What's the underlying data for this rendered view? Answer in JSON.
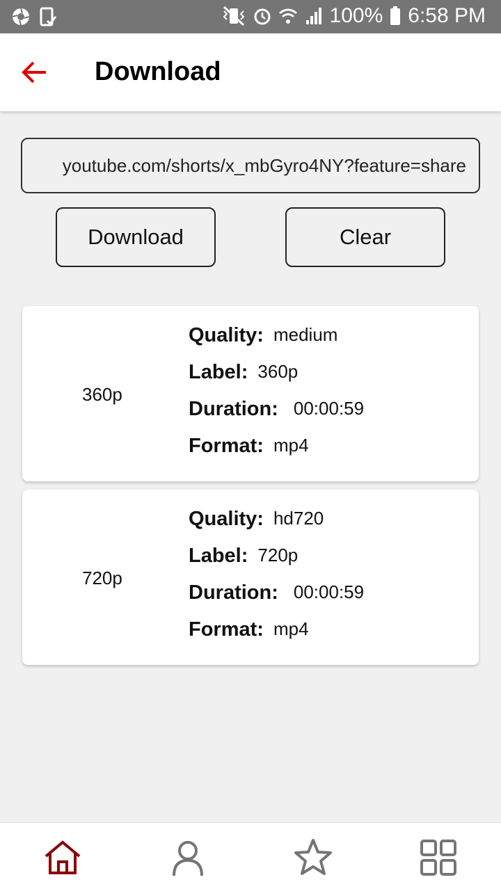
{
  "status_bar": {
    "battery": "100%",
    "time": "6:58 PM"
  },
  "app_bar": {
    "title": "Download"
  },
  "url_input": {
    "value": "youtube.com/shorts/x_mbGyro4NY?feature=share"
  },
  "buttons": {
    "download_label": "Download",
    "clear_label": "Clear"
  },
  "formats": [
    {
      "resolution": "360p",
      "quality_key": "Quality:",
      "quality": "medium",
      "label_key": "Label:",
      "label": "360p",
      "duration_key": "Duration:",
      "duration": "00:00:59",
      "format_key": "Format:",
      "format": "mp4"
    },
    {
      "resolution": "720p",
      "quality_key": "Quality:",
      "quality": "hd720",
      "label_key": "Label:",
      "label": "720p",
      "duration_key": "Duration:",
      "duration": "00:00:59",
      "format_key": "Format:",
      "format": "mp4"
    }
  ],
  "bottom_nav": {
    "items": [
      "home-icon",
      "profile-icon",
      "star-icon",
      "grid-icon"
    ],
    "active_color": "#8b0000",
    "inactive_color": "#757575"
  },
  "colors": {
    "accent": "#e00000",
    "status_bar": "#757575",
    "background": "#f0f0f0"
  }
}
